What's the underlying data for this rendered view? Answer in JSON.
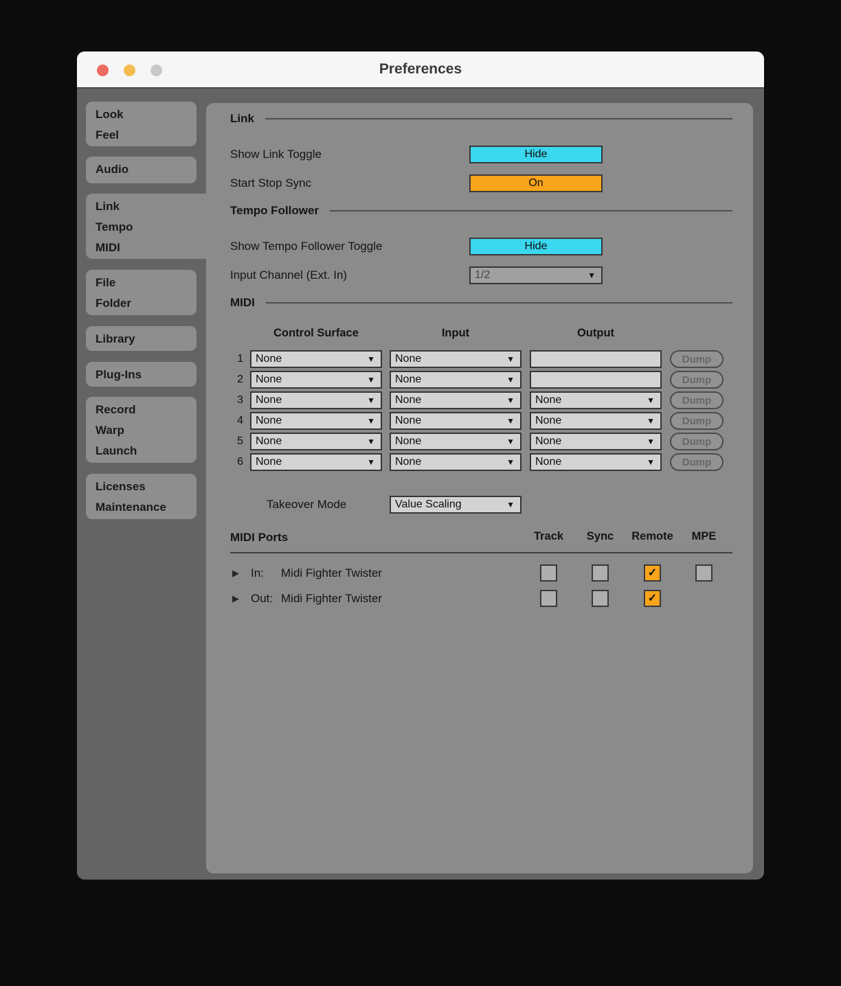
{
  "colors": {
    "cyan": "#3bd7ef",
    "orange": "#f9a41b"
  },
  "glyphs": {
    "dropdown": "▼",
    "expand": "▶",
    "check": "✓"
  },
  "titlebar": {
    "title": "Preferences"
  },
  "sidebar": {
    "tabs": [
      {
        "lines": [
          "Look",
          "Feel"
        ]
      },
      {
        "lines": [
          "Audio"
        ]
      },
      {
        "lines": [
          "Link",
          "Tempo",
          "MIDI"
        ],
        "selected": true
      },
      {
        "lines": [
          "File",
          "Folder"
        ]
      },
      {
        "lines": [
          "Library"
        ]
      },
      {
        "lines": [
          "Plug-Ins"
        ]
      },
      {
        "lines": [
          "Record",
          "Warp",
          "Launch"
        ]
      },
      {
        "lines": [
          "Licenses",
          "Maintenance"
        ]
      }
    ]
  },
  "link_section": {
    "title": "Link",
    "show_link_label": "Show Link Toggle",
    "show_link_value": "Hide",
    "start_stop_label": "Start Stop Sync",
    "start_stop_value": "On"
  },
  "tempo_section": {
    "title": "Tempo Follower",
    "toggle_label": "Show Tempo Follower Toggle",
    "toggle_value": "Hide",
    "channel_label": "Input Channel (Ext. In)",
    "channel_value": "1/2"
  },
  "midi": {
    "title": "MIDI",
    "columns": [
      "Control Surface",
      "Input",
      "Output"
    ],
    "dump_label": "Dump",
    "rows": [
      {
        "index": "1",
        "control_surface": "None",
        "input": "None",
        "output": ""
      },
      {
        "index": "2",
        "control_surface": "None",
        "input": "None",
        "output": ""
      },
      {
        "index": "3",
        "control_surface": "None",
        "input": "None",
        "output": "None"
      },
      {
        "index": "4",
        "control_surface": "None",
        "input": "None",
        "output": "None"
      },
      {
        "index": "5",
        "control_surface": "None",
        "input": "None",
        "output": "None"
      },
      {
        "index": "6",
        "control_surface": "None",
        "input": "None",
        "output": "None"
      }
    ],
    "takeover_label": "Takeover Mode",
    "takeover_value": "Value Scaling"
  },
  "midi_ports": {
    "title": "MIDI Ports",
    "columns": [
      "Track",
      "Sync",
      "Remote",
      "MPE"
    ],
    "rows": [
      {
        "prefix": "In:",
        "name": "Midi Fighter Twister",
        "track": false,
        "sync": false,
        "remote": true,
        "mpe": false
      },
      {
        "prefix": "Out:",
        "name": "Midi Fighter Twister",
        "track": false,
        "sync": false,
        "remote": true
      }
    ]
  }
}
